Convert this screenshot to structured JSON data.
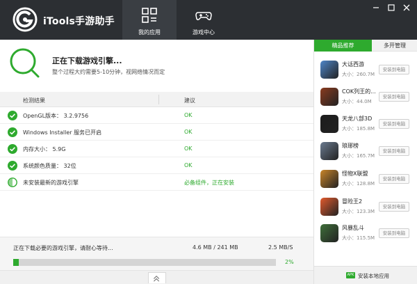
{
  "app": {
    "title": "iTools手游助手"
  },
  "nav": {
    "tabs": [
      {
        "label": "我的应用",
        "icon": "apps-grid-icon",
        "active": true
      },
      {
        "label": "游戏中心",
        "icon": "gamepad-icon",
        "active": false
      }
    ]
  },
  "window_controls": [
    "minimize-icon",
    "restore-icon",
    "close-icon"
  ],
  "status": {
    "title": "正在下载游戏引擎...",
    "subtitle": "整个过程大约需要5-10分钟，视网络情况而定"
  },
  "results": {
    "headers": {
      "item": "检测结果",
      "advice": "建议"
    },
    "rows": [
      {
        "item": "OpenGL版本： 3.2.9756",
        "advice": "OK",
        "state": "ok"
      },
      {
        "item": "Windows Installer 服务已开启",
        "advice": "OK",
        "state": "ok"
      },
      {
        "item": "内存大小： 5.9G",
        "advice": "OK",
        "state": "ok"
      },
      {
        "item": "系统颜色质量： 32位",
        "advice": "OK",
        "state": "ok"
      },
      {
        "item": "未安装最新的游戏引擎",
        "advice": "必备组件，正在安装",
        "state": "progress"
      }
    ]
  },
  "progress": {
    "message": "正在下载必要的游戏引擎，请耐心等待...",
    "size": "4.6 MB / 241 MB",
    "speed": "2.5 MB/S",
    "percent_label": "2%",
    "fraction": 0.02
  },
  "side": {
    "tabs": [
      {
        "label": "精品推荐",
        "active": true
      },
      {
        "label": "多开管理",
        "active": false
      }
    ],
    "apps": [
      {
        "name": "大话西游",
        "size": "大小：260.7M",
        "button": "安装到电脑",
        "color": "#4f86c8"
      },
      {
        "name": "COK列王的...",
        "size": "大小：44.0M",
        "button": "安装到电脑",
        "color": "#8a3b1f"
      },
      {
        "name": "天龙八部3D",
        "size": "大小：185.8M",
        "button": "安装到电脑",
        "color": "#1c1c1c"
      },
      {
        "name": "琅琊榜",
        "size": "大小：165.7M",
        "button": "安装到电脑",
        "color": "#6a7a8f"
      },
      {
        "name": "怪物X联盟",
        "size": "大小：128.8M",
        "button": "安装到电脑",
        "color": "#c9852a"
      },
      {
        "name": "冒险王2",
        "size": "大小：123.3M",
        "button": "安装到电脑",
        "color": "#e25a2d"
      },
      {
        "name": "风暴乱斗",
        "size": "大小：115.5M",
        "button": "安装到电脑",
        "color": "#3f6f3a"
      }
    ],
    "footer": {
      "badge": "APK",
      "label": "安装本地应用"
    }
  },
  "colors": {
    "accent": "#2eaa2e",
    "header_bg": "#2c2f33"
  }
}
